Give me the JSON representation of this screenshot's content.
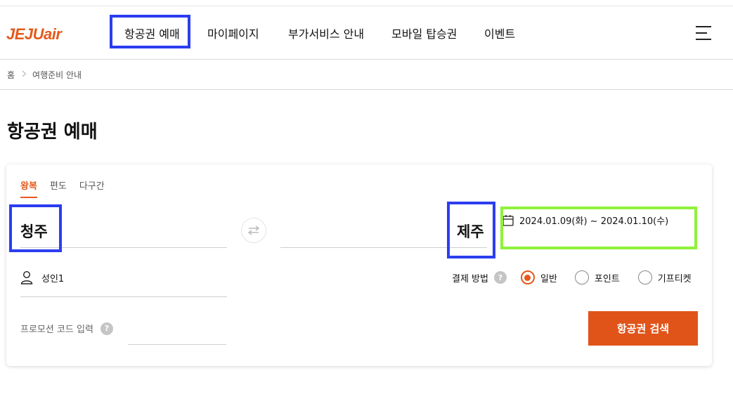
{
  "header": {
    "logo_text": "JEJUair",
    "brand_color": "#e35a1b",
    "nav": [
      {
        "label": "항공권 예매"
      },
      {
        "label": "마이페이지"
      },
      {
        "label": "부가서비스 안내"
      },
      {
        "label": "모바일 탑승권"
      },
      {
        "label": "이벤트"
      }
    ],
    "menu_icon": "hamburger-icon"
  },
  "breadcrumb": {
    "home": "홈",
    "separator_icon": "chevron-right-icon",
    "current": "여행준비 안내"
  },
  "page_title": "항공권 예매",
  "booking": {
    "tabs": [
      {
        "label": "왕복",
        "active": true
      },
      {
        "label": "편도",
        "active": false
      },
      {
        "label": "다구간",
        "active": false
      }
    ],
    "origin": "청주",
    "swap_icon": "swap-arrows-icon",
    "destination": "제주",
    "calendar_icon": "calendar-icon",
    "dates": "2024.01.09(화) ~ 2024.01.10(수)",
    "person_icon": "person-icon",
    "passengers": "성인1",
    "payment_label": "결제 방법",
    "help_icon": "question-icon",
    "help_mark": "?",
    "payment_options": [
      {
        "label": "일반",
        "selected": true
      },
      {
        "label": "포인트",
        "selected": false
      },
      {
        "label": "기프티켓",
        "selected": false
      }
    ],
    "promo_label": "프로모션 코드 입력",
    "search_label": "항공권 검색",
    "search_color": "#e0541a"
  },
  "highlight_colors": {
    "blue": "#2b3ef0",
    "green": "#8ef23a"
  }
}
